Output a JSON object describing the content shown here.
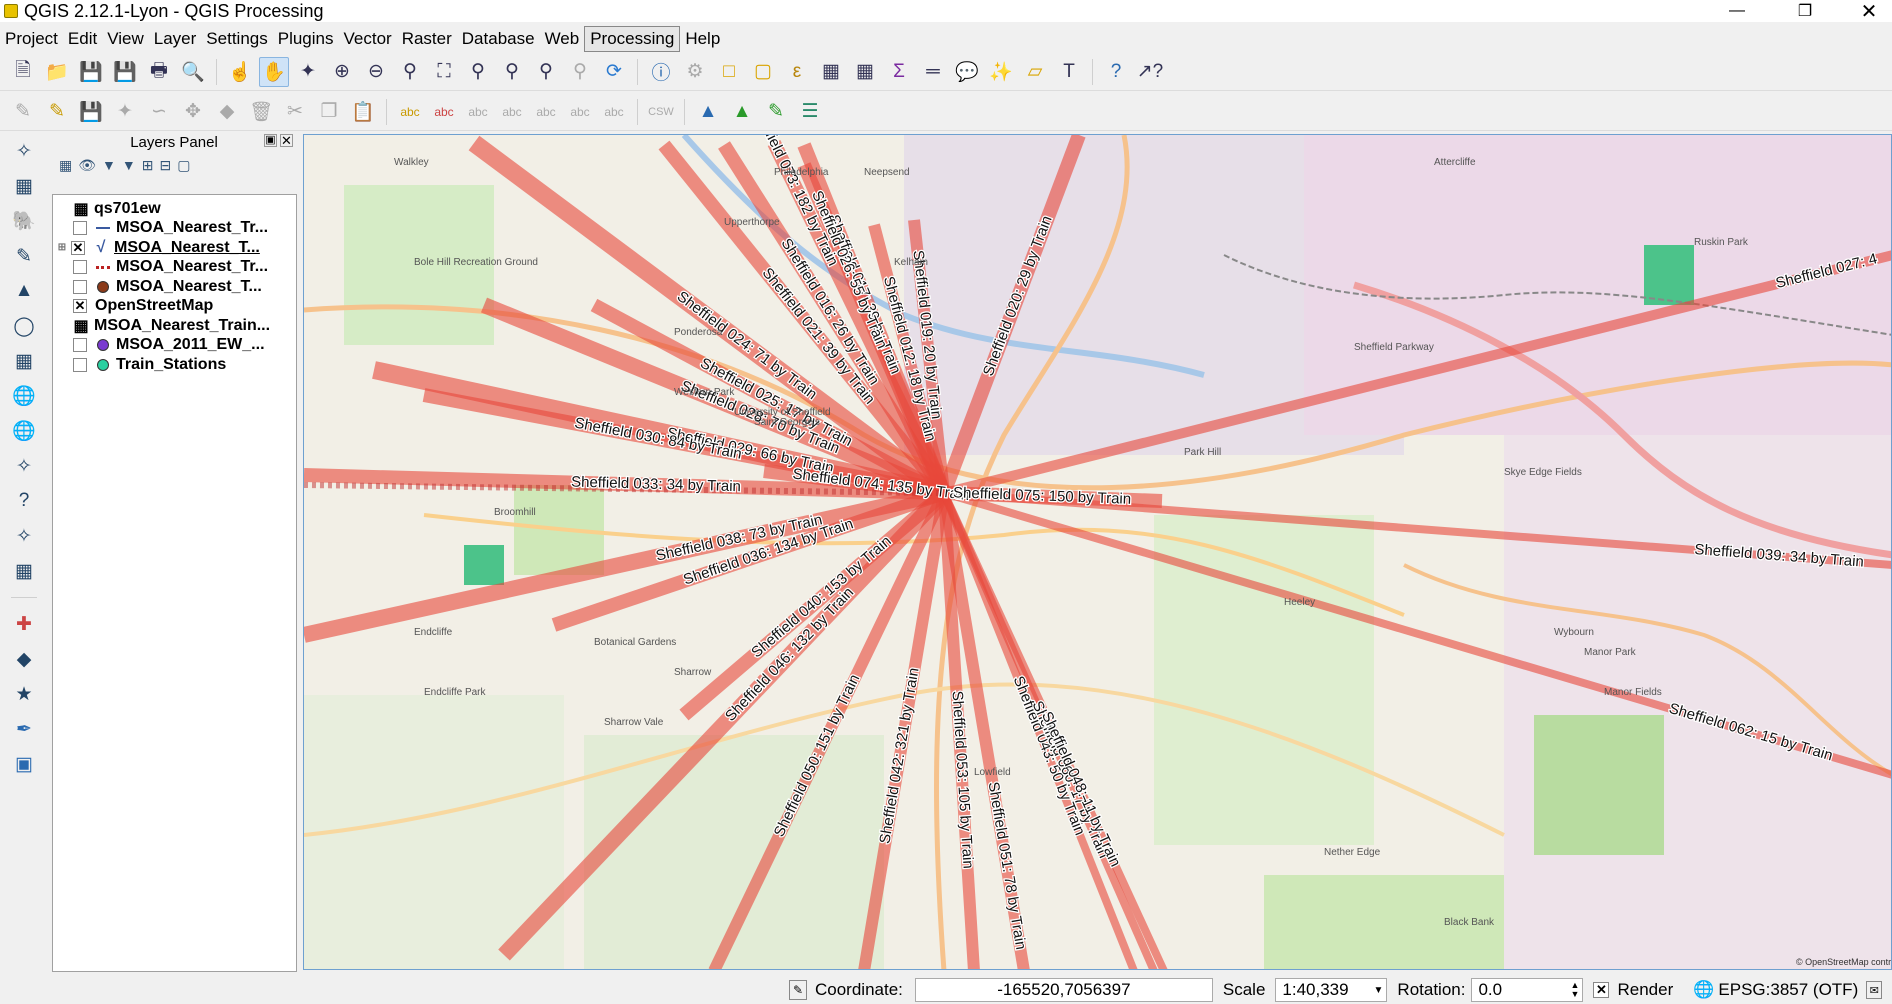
{
  "window": {
    "title": "QGIS 2.12.1-Lyon - QGIS Processing"
  },
  "menu": [
    "Project",
    "Edit",
    "View",
    "Layer",
    "Settings",
    "Plugins",
    "Vector",
    "Raster",
    "Database",
    "Web",
    "Processing",
    "Help"
  ],
  "menu_active": "Processing",
  "layers_panel": {
    "title": "Layers Panel",
    "layers": [
      {
        "name": "qs701ew",
        "checked": false,
        "symbol": "table-icon"
      },
      {
        "name": "MSOA_Nearest_Tr...",
        "checked": false,
        "symbol": "line-icon"
      },
      {
        "name": "MSOA_Nearest_T...",
        "checked": true,
        "symbol": "vector-line-icon",
        "selected": true
      },
      {
        "name": "MSOA_Nearest_Tr...",
        "checked": false,
        "symbol": "dashed-line-icon"
      },
      {
        "name": "MSOA_Nearest_T...",
        "checked": false,
        "symbol": "point-brown-icon"
      },
      {
        "name": "OpenStreetMap",
        "checked": true,
        "symbol": "none"
      },
      {
        "name": "MSOA_Nearest_Train...",
        "checked": false,
        "symbol": "table-icon"
      },
      {
        "name": "MSOA_2011_EW_...",
        "checked": false,
        "symbol": "point-purple-icon"
      },
      {
        "name": "Train_Stations",
        "checked": false,
        "symbol": "point-green-icon"
      }
    ]
  },
  "map": {
    "line_labels": [
      "Sheffield 024: 71 by Train",
      "Sheffield 021: 39 by Train",
      "Sheffield 016: 26 by Train",
      "Sheffield 017: 39 by Train",
      "Sheffield 012: 18 by Train",
      "Sheffield 019: 20 by Train",
      "Sheffield 020: 29 by Train",
      "Sheffield 026: 55 by Train",
      "Sheffield 073: 182 by Train",
      "Sheffield 025: 17 by Train",
      "Sheffield 028: 70 by Train",
      "Sheffield 029: 66 by Train",
      "Sheffield 030: 84 by Train",
      "Sheffield 033: 34 by Train",
      "Sheffield 074: 135 by Train",
      "Sheffield 075: 150 by Train",
      "Sheffield 038: 73 by Train",
      "Sheffield 036: 134 by Train",
      "Sheffield 040: 153 by Train",
      "Sheffield 046: 132 by Train",
      "Sheffield 050: 151 by Train",
      "Sheffield 042: 321 by Train",
      "Sheffield 053: 105 by Train",
      "Sheffield 051: 78 by Train",
      "Sheffield 043: 50 by Train",
      "Sheffield 060: 17 by Train",
      "Sheffield 048: 11 by Train",
      "Sheffield 027: 4",
      "Sheffield 039: 34 by Train",
      "Sheffield 062: 15 by Train"
    ],
    "place_labels": [
      "Walkley",
      "Neepsend",
      "Philadelphia",
      "Upperthorpe",
      "Kelham",
      "Attercliffe",
      "Bole Hill Recreation Ground",
      "Ponderosa",
      "Western Park",
      "University of Sheffield",
      "Saint George's",
      "Park Hill",
      "Skye Edge Fields",
      "Broomhill",
      "Endcliffe",
      "Sharrow",
      "Sharrow Vale",
      "Nether Edge",
      "Manor Park",
      "Manor Fields",
      "Wybourn",
      "Black Bank",
      "Heeley",
      "Lowfield",
      "Sheffield Parkway",
      "Ruskin Park",
      "Botanical Gardens",
      "Endcliffe Park"
    ],
    "attribution": "© OpenStreetMap contri"
  },
  "status": {
    "coordinate_label": "Coordinate:",
    "coordinate": "-165520,7056397",
    "scale_label": "Scale",
    "scale": "1:40,339",
    "rotation_label": "Rotation:",
    "rotation": "0.0",
    "render_label": "Render",
    "crs": "EPSG:3857 (OTF)"
  },
  "colors": {
    "accent": "#e8483a",
    "selection": "#cfe3f7",
    "map_bg": "#f2efe6"
  }
}
